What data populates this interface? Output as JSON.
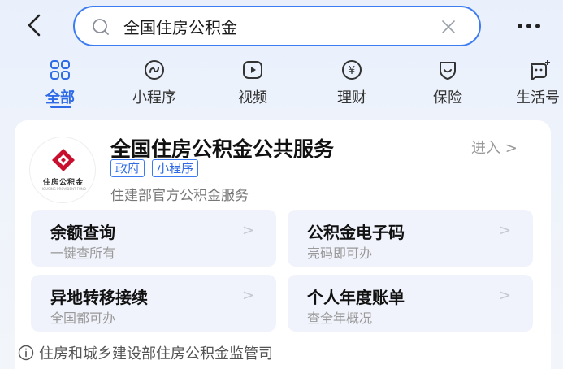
{
  "search": {
    "value": "全国住房公积金",
    "placeholder": ""
  },
  "tabs": [
    {
      "label": "全部",
      "icon": "grid-icon",
      "active": true
    },
    {
      "label": "小程序",
      "icon": "mini-program-icon"
    },
    {
      "label": "视频",
      "icon": "video-play-icon"
    },
    {
      "label": "理财",
      "icon": "yuan-icon"
    },
    {
      "label": "保险",
      "icon": "shield-icon"
    },
    {
      "label": "生活号",
      "icon": "chat-plus-icon"
    }
  ],
  "service": {
    "logo_text": "住房公积金",
    "logo_subtext": "HOUSING PROVIDENT FUND",
    "title": "全国住房公积金公共服务",
    "enter_label": "进入",
    "tags": [
      "政府",
      "小程序"
    ],
    "description": "住建部官方公积金服务",
    "tiles": [
      {
        "title": "余额查询",
        "subtitle": "一键查所有"
      },
      {
        "title": "公积金电子码",
        "subtitle": "亮码即可办"
      },
      {
        "title": "异地转移接续",
        "subtitle": "全国都可办"
      },
      {
        "title": "个人年度账单",
        "subtitle": "查全年概况"
      }
    ],
    "footer": "住房和城乡建设部住房公积金监管司"
  },
  "colors": {
    "accent": "#2f6be6",
    "logo_red": "#c8102e"
  }
}
